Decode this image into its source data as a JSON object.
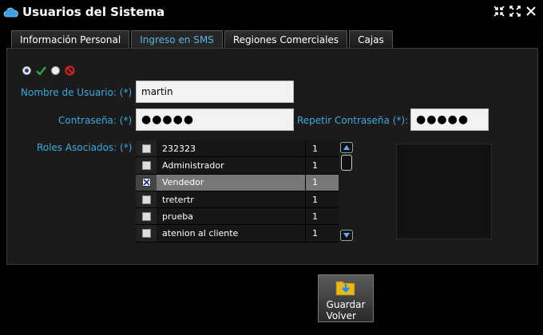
{
  "window": {
    "title": "Usuarios del Sistema"
  },
  "tabs": [
    {
      "label": "Información Personal",
      "active": false
    },
    {
      "label": "Ingreso en SMS",
      "active": true
    },
    {
      "label": "Regiones Comerciales",
      "active": false
    },
    {
      "label": "Cajas",
      "active": false
    }
  ],
  "form": {
    "username_label": "Nombre de Usuario: (*)",
    "username_value": "martin",
    "password_label": "Contraseña: (*)",
    "password_value": "●●●●●",
    "repeat_password_label": "Repetir Contraseña (*):",
    "repeat_password_value": "●●●●●",
    "roles_label": "Roles Asociados: (*)"
  },
  "roles": [
    {
      "name": "232323",
      "value": "1",
      "checked": false
    },
    {
      "name": "Administrador",
      "value": "1",
      "checked": false
    },
    {
      "name": "Vendedor",
      "value": "1",
      "checked": true
    },
    {
      "name": "tretertr",
      "value": "1",
      "checked": false
    },
    {
      "name": "prueba",
      "value": "1",
      "checked": false
    },
    {
      "name": "atenion al cliente",
      "value": "1",
      "checked": false
    }
  ],
  "save_button": {
    "line1": "Guardar",
    "line2": "Volver"
  },
  "colors": {
    "label": "#3fa9df",
    "active_tab": "#5ab4e6",
    "check_ok": "#2aa84a",
    "deny": "#e02020"
  }
}
